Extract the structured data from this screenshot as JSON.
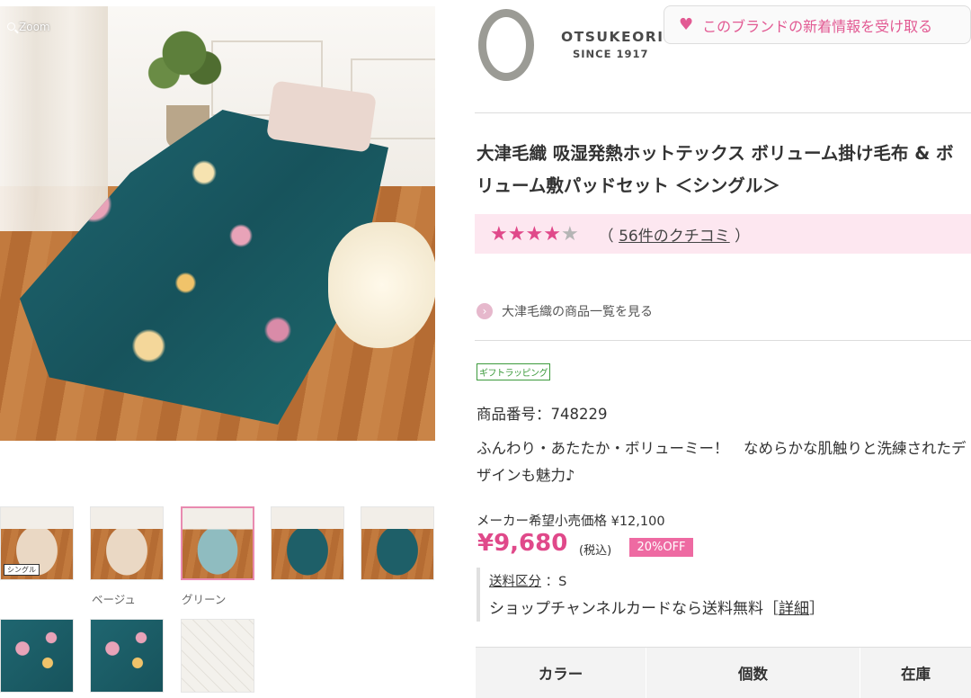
{
  "gallery": {
    "zoom_label": "Zoom",
    "thumbs": [
      {
        "tag": "シングル",
        "caption": ""
      },
      {
        "tag": "",
        "caption": "ベージュ"
      },
      {
        "tag": "",
        "caption": "グリーン"
      },
      {
        "tag": "",
        "caption": ""
      },
      {
        "tag": "",
        "caption": ""
      },
      {
        "tag": "",
        "caption": ""
      },
      {
        "tag": "",
        "caption": ""
      },
      {
        "tag": "",
        "caption": ""
      }
    ]
  },
  "brand": {
    "name": "OTSUKEORI",
    "since": "SINCE 1917",
    "follow_label": "このブランドの新着情報を受け取る",
    "all_products_link": "大津毛織の商品一覧を見る"
  },
  "product": {
    "title": "大津毛織 吸湿発熱ホットテックス ボリューム掛け毛布 & ボリューム敷パッドセット ＜シングル＞",
    "rating": 4,
    "rating_max": 5,
    "reviews_open": "（",
    "reviews_link": "56件のクチコミ",
    "reviews_close": "）",
    "gift_label": "ギフトラッピング",
    "product_no": "商品番号：748229",
    "description": "ふんわり・あたたか・ボリューミー！　なめらかな肌触りと洗練されたデザインも魅力♪",
    "maker_price": "メーカー希望小売価格 ¥12,100",
    "price": "¥9,680",
    "tax_note": "(税込)",
    "discount_badge": "20%OFF",
    "shipping_label": "送料区分",
    "shipping_value": "：S",
    "free_shipping_text": "ショップチャンネルカードなら送料無料［",
    "free_shipping_link": "詳細",
    "free_shipping_close": "］"
  },
  "options_table": {
    "headers": [
      "カラー",
      "個数",
      "在庫"
    ]
  },
  "colors": {
    "accent_pink": "#e0498a",
    "rating_bg": "#fde7f0",
    "badge_pink": "#ee6aa2"
  }
}
